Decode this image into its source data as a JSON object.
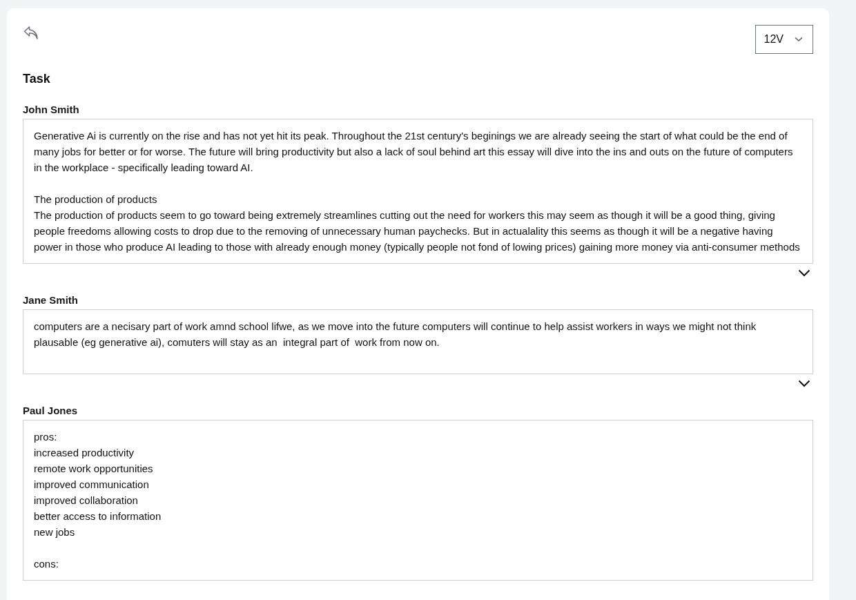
{
  "header": {
    "version_select": {
      "value": "12V"
    }
  },
  "title": "Task",
  "responses": [
    {
      "author": "John Smith",
      "text": "Generative Ai is currently on the rise and has not yet hit its peak. Throughout the 21st century's beginings we are already seeing the start of what could be the end of many jobs for better or for worse. The future will bring productivity but also a lack of soul behind art this essay will dive into the ins and outs on the future of computers in the workplace - specifically leading toward AI.\n\nThe production of products\nThe production of products seem to go toward being extremely streamlines cutting out the need for workers this may seem as though it will be a good thing, giving people freedoms allowing costs to drop due to the removing of unnecessary human paychecks. But in actualality this seems as though it will be a negative having power in those who produce AI leading to those with already enough money (typically people not fond of lowing prices) gaining more money via anti-consumer methods",
      "expanded": false
    },
    {
      "author": "Jane Smith",
      "text": "computers are a necisary part of work amnd school lifwe, as we move into the future computers will continue to help assist workers in ways we might not think plausable (eg generative ai), comuters will stay as an  integral part of  work from now on.",
      "expanded": false
    },
    {
      "author": "Paul Jones",
      "text": "pros:\nincreased productivity\nremote work opportunities\nimproved communication\nimproved collaboration\nbetter access to information\nnew jobs\n\ncons:"
    }
  ]
}
